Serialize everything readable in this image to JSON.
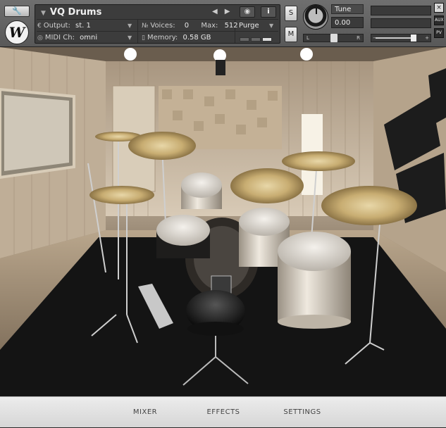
{
  "header": {
    "instrument_name": "VQ Drums",
    "output_label": "Output:",
    "output_value": "st. 1",
    "midi_label": "MIDI Ch:",
    "midi_value": "omni",
    "voices_label": "Voices:",
    "voices_value": "0",
    "max_label": "Max:",
    "max_value": "512",
    "memory_label": "Memory:",
    "memory_value": "0.58 GB",
    "purge_label": "Purge",
    "solo_label": "S",
    "mute_label": "M",
    "tune_label": "Tune",
    "tune_value": "0.00",
    "pan_left": "L",
    "pan_right": "R",
    "vol_left": "−",
    "vol_right": "+",
    "aux_label": "AUX",
    "pv_label": "PV",
    "close_label": "×",
    "logo_letter": "W",
    "icons": {
      "wrench": "wrench-icon",
      "camera": "camera-icon",
      "info": "info-icon"
    }
  },
  "tabs": [
    "MIXER",
    "EFFECTS",
    "SETTINGS"
  ],
  "colors": {
    "header_bg": "#666666",
    "panel_bg": "#3c3c3c",
    "tab_bar_bg": "#e2e2e2",
    "carpet": "#151515",
    "wood_wall": "#c9b9a4"
  }
}
